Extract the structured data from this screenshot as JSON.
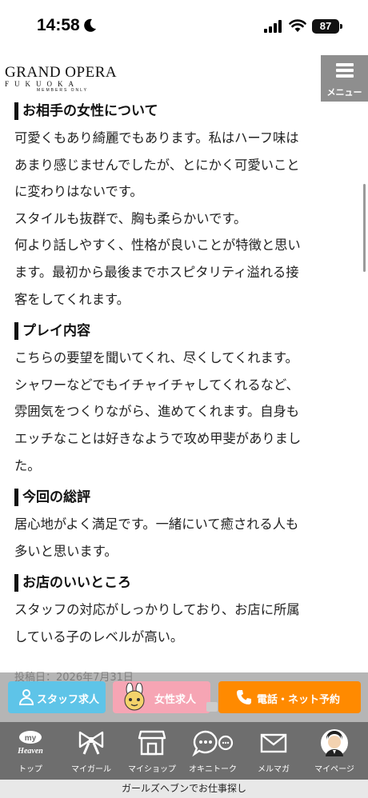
{
  "status_bar": {
    "time": "14:58",
    "battery": "87"
  },
  "header": {
    "logo_main": "GRAND OPERA",
    "logo_sub": "FUKUOKA",
    "logo_members": "MEMBERS ONLY",
    "menu_label": "メニュー"
  },
  "sections": [
    {
      "title": "お相手の女性について",
      "lines": [
        "可愛くもあり綺麗でもあります。私はハーフ味は",
        "あまり感じませんでしたが、とにかく可愛いこと",
        "に変わりはないです。",
        "スタイルも抜群で、胸も柔らかいです。",
        "何より話しやすく、性格が良いことが特徴と思い",
        "ます。最初から最後までホスピタリティ溢れる接",
        "客をしてくれます。"
      ]
    },
    {
      "title": "プレイ内容",
      "lines": [
        "こちらの要望を聞いてくれ、尽くしてくれます。",
        "シャワーなどでもイチャイチャしてくれるなど、",
        "雰囲気をつくりながら、進めてくれます。自身も",
        "エッチなことは好きなようで攻め甲斐がありまし",
        "た。"
      ]
    },
    {
      "title": "今回の総評",
      "lines": [
        "居心地がよく満足です。一緒にいて癒される人も",
        "多いと思います。"
      ]
    },
    {
      "title": "お店のいいところ",
      "lines": [
        "スタッフの対応がしっかりしており、お店に所属",
        "している子のレベルが高い。"
      ]
    }
  ],
  "posted_date": "投稿日：2026年7月31日",
  "cta": {
    "staff": "スタッフ求人",
    "female": "女性求人",
    "phone": "電話・ネット予約"
  },
  "bottom_nav": [
    {
      "label": "トップ",
      "icon": "my-heaven-icon"
    },
    {
      "label": "マイガール",
      "icon": "ribbon-icon"
    },
    {
      "label": "マイショップ",
      "icon": "shop-icon"
    },
    {
      "label": "オキニトーク",
      "icon": "chat-bubbles-icon"
    },
    {
      "label": "メルマガ",
      "icon": "mail-icon"
    },
    {
      "label": "マイページ",
      "icon": "avatar-icon"
    }
  ],
  "footer": "ガールズヘブンでお仕事探し",
  "colors": {
    "staff": "#5ec4e8",
    "female": "#f6a5b4",
    "phone": "#ff8a00",
    "nav_bg": "#6e6e6e",
    "menu_bg": "#8e8e8e"
  }
}
